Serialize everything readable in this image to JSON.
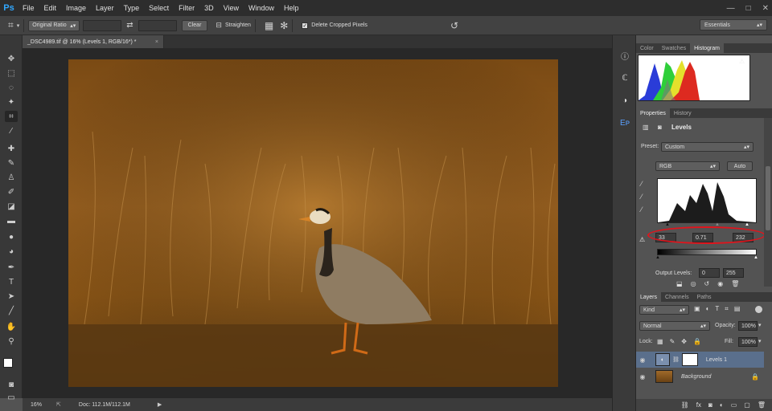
{
  "app": {
    "logo": "Ps"
  },
  "menu": [
    "File",
    "Edit",
    "Image",
    "Layer",
    "Type",
    "Select",
    "Filter",
    "3D",
    "View",
    "Window",
    "Help"
  ],
  "window_controls": {
    "minimize": "—",
    "maximize": "□",
    "close": "✕"
  },
  "options": {
    "ratio": "Original Ratio",
    "clear": "Clear",
    "straighten": "Straighten",
    "delete_cropped": "Delete Cropped Pixels",
    "workspace": "Essentials"
  },
  "document": {
    "tab_title": "_DSC4989.tif @ 16% (Levels 1, RGB/16*) *",
    "close": "×"
  },
  "status": {
    "zoom": "16%",
    "doc_info": "Doc: 112.1M/112.1M"
  },
  "panels": {
    "top_tabs": [
      "Color",
      "Swatches",
      "Histogram"
    ],
    "props_tabs": [
      "Properties",
      "History"
    ],
    "adjustment_title": "Levels",
    "preset_label": "Preset:",
    "preset_value": "Custom",
    "channel": "RGB",
    "auto": "Auto",
    "input_black": "33",
    "input_gamma": "0.71",
    "input_white": "232",
    "output_label": "Output Levels:",
    "output_black": "0",
    "output_white": "255",
    "layer_tabs": [
      "Layers",
      "Channels",
      "Paths"
    ],
    "kind": "Kind",
    "blend_mode": "Normal",
    "opacity_label": "Opacity:",
    "opacity": "100%",
    "lock_label": "Lock:",
    "fill_label": "Fill:",
    "fill": "100%",
    "layers": [
      {
        "name": "Levels 1"
      },
      {
        "name": "Background"
      }
    ]
  },
  "colors": {
    "accent": "#31a8ff",
    "highlight_ring": "#e0141c",
    "selected_layer": "#5a6f8c"
  }
}
